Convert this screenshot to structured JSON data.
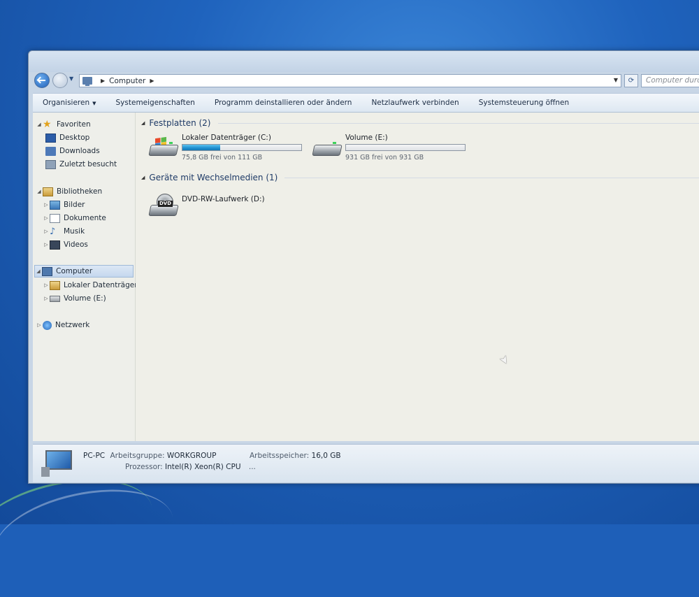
{
  "address": {
    "location": "Computer",
    "search_placeholder": "Computer durchsuchen"
  },
  "toolbar": {
    "organize": "Organisieren",
    "system_properties": "Systemeigenschaften",
    "uninstall": "Programm deinstallieren oder ändern",
    "map_drive": "Netzlaufwerk verbinden",
    "control_panel": "Systemsteuerung öffnen"
  },
  "nav": {
    "favorites": "Favoriten",
    "desktop": "Desktop",
    "downloads": "Downloads",
    "recent": "Zuletzt besucht",
    "libraries": "Bibliotheken",
    "pictures": "Bilder",
    "documents": "Dokumente",
    "music": "Musik",
    "videos": "Videos",
    "computer": "Computer",
    "local_disk": "Lokaler Datenträger",
    "volume_e": "Volume (E:)",
    "network": "Netzwerk"
  },
  "groups": {
    "hard_disks": "Festplatten (2)",
    "removable": "Geräte mit Wechselmedien (1)"
  },
  "drives": [
    {
      "name": "Lokaler Datenträger (C:)",
      "free_text": "75,8 GB frei von 111 GB",
      "used_fraction": 0.32
    },
    {
      "name": "Volume (E:)",
      "free_text": "931 GB frei von 931 GB",
      "used_fraction": 0.0
    }
  ],
  "dvd": {
    "name": "DVD-RW-Laufwerk (D:)",
    "badge": "DVD"
  },
  "details": {
    "pc_name": "PC-PC",
    "workgroup_label": "Arbeitsgruppe:",
    "workgroup_value": "WORKGROUP",
    "memory_label": "Arbeitsspeicher:",
    "memory_value": "16,0 GB",
    "cpu_label": "Prozessor:",
    "cpu_value": "Intel(R) Xeon(R) CPU",
    "cpu_more": "..."
  }
}
